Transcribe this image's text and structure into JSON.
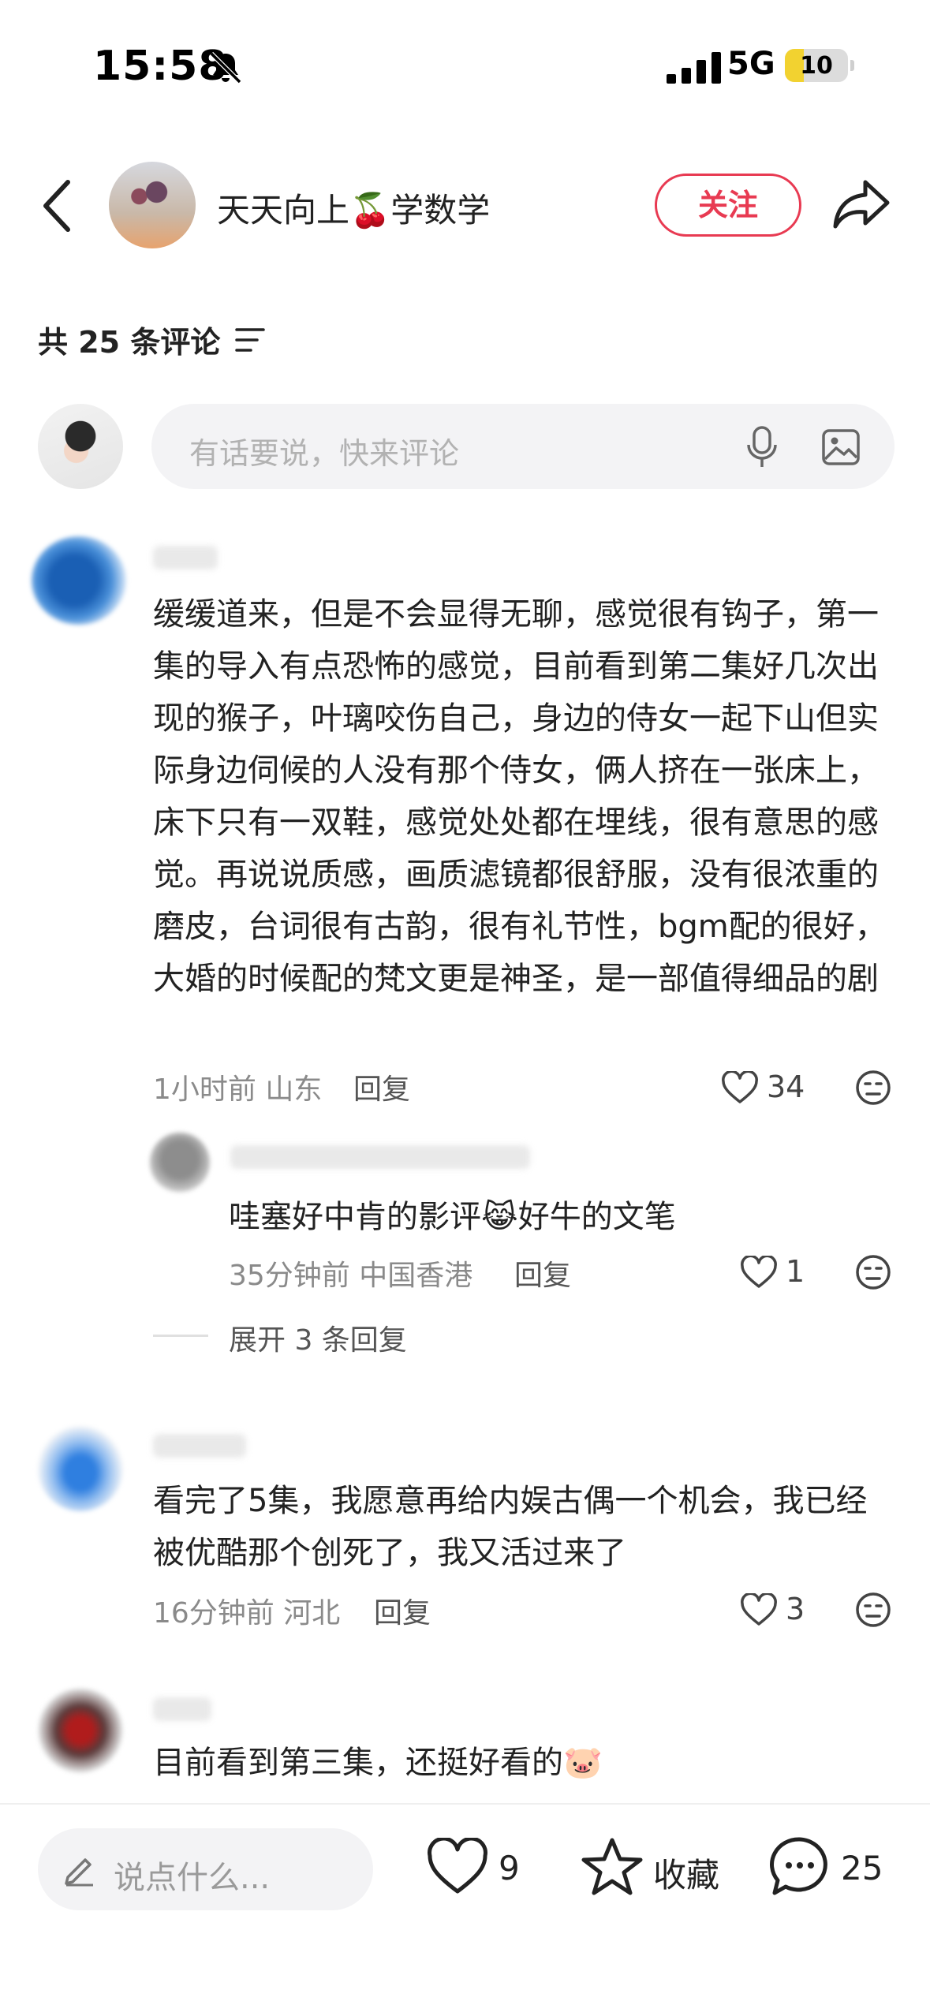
{
  "status_bar": {
    "time": "15:58",
    "network": "5G",
    "battery": "10"
  },
  "header": {
    "username": "天天向上🍒学数学",
    "follow_label": "关注"
  },
  "comments_header": {
    "count_label": "共 25 条评论"
  },
  "comment_input": {
    "placeholder": "有话要说，快来评论"
  },
  "comments": [
    {
      "text": "缓缓道来，但是不会显得无聊，感觉很有钩子，第一集的导入有点恐怖的感觉，目前看到第二集好几次出现的猴子，叶璃咬伤自己，身边的侍女一起下山但实际身边伺候的人没有那个侍女，俩人挤在一张床上，床下只有一双鞋，感觉处处都在埋线，很有意思的感觉。再说说质感，画质滤镜都很舒服，没有很浓重的磨皮，台词很有古韵，很有礼节性，bgm配的很好，大婚的时候配的梵文更是神圣，是一部值得细品的剧",
      "time_location": "1小时前 山东",
      "reply_label": "回复",
      "likes": "34",
      "sub_reply": {
        "text": "哇塞好中肯的影评😹好牛的文笔",
        "time_location": "35分钟前 中国香港",
        "reply_label": "回复",
        "likes": "1"
      },
      "expand_label": "展开 3 条回复"
    },
    {
      "text": "看完了5集，我愿意再给内娱古偶一个机会，我已经被优酷那个创死了，我又活过来了",
      "time_location": "16分钟前 河北",
      "reply_label": "回复",
      "likes": "3"
    },
    {
      "text": "目前看到第三集，还挺好看的🐷"
    }
  ],
  "bottom_bar": {
    "say_placeholder": "说点什么...",
    "like_count": "9",
    "favorite_label": "收藏",
    "comment_count": "25"
  },
  "colors": {
    "accent": "#e83a52",
    "battery_fill": "#f2d230"
  }
}
